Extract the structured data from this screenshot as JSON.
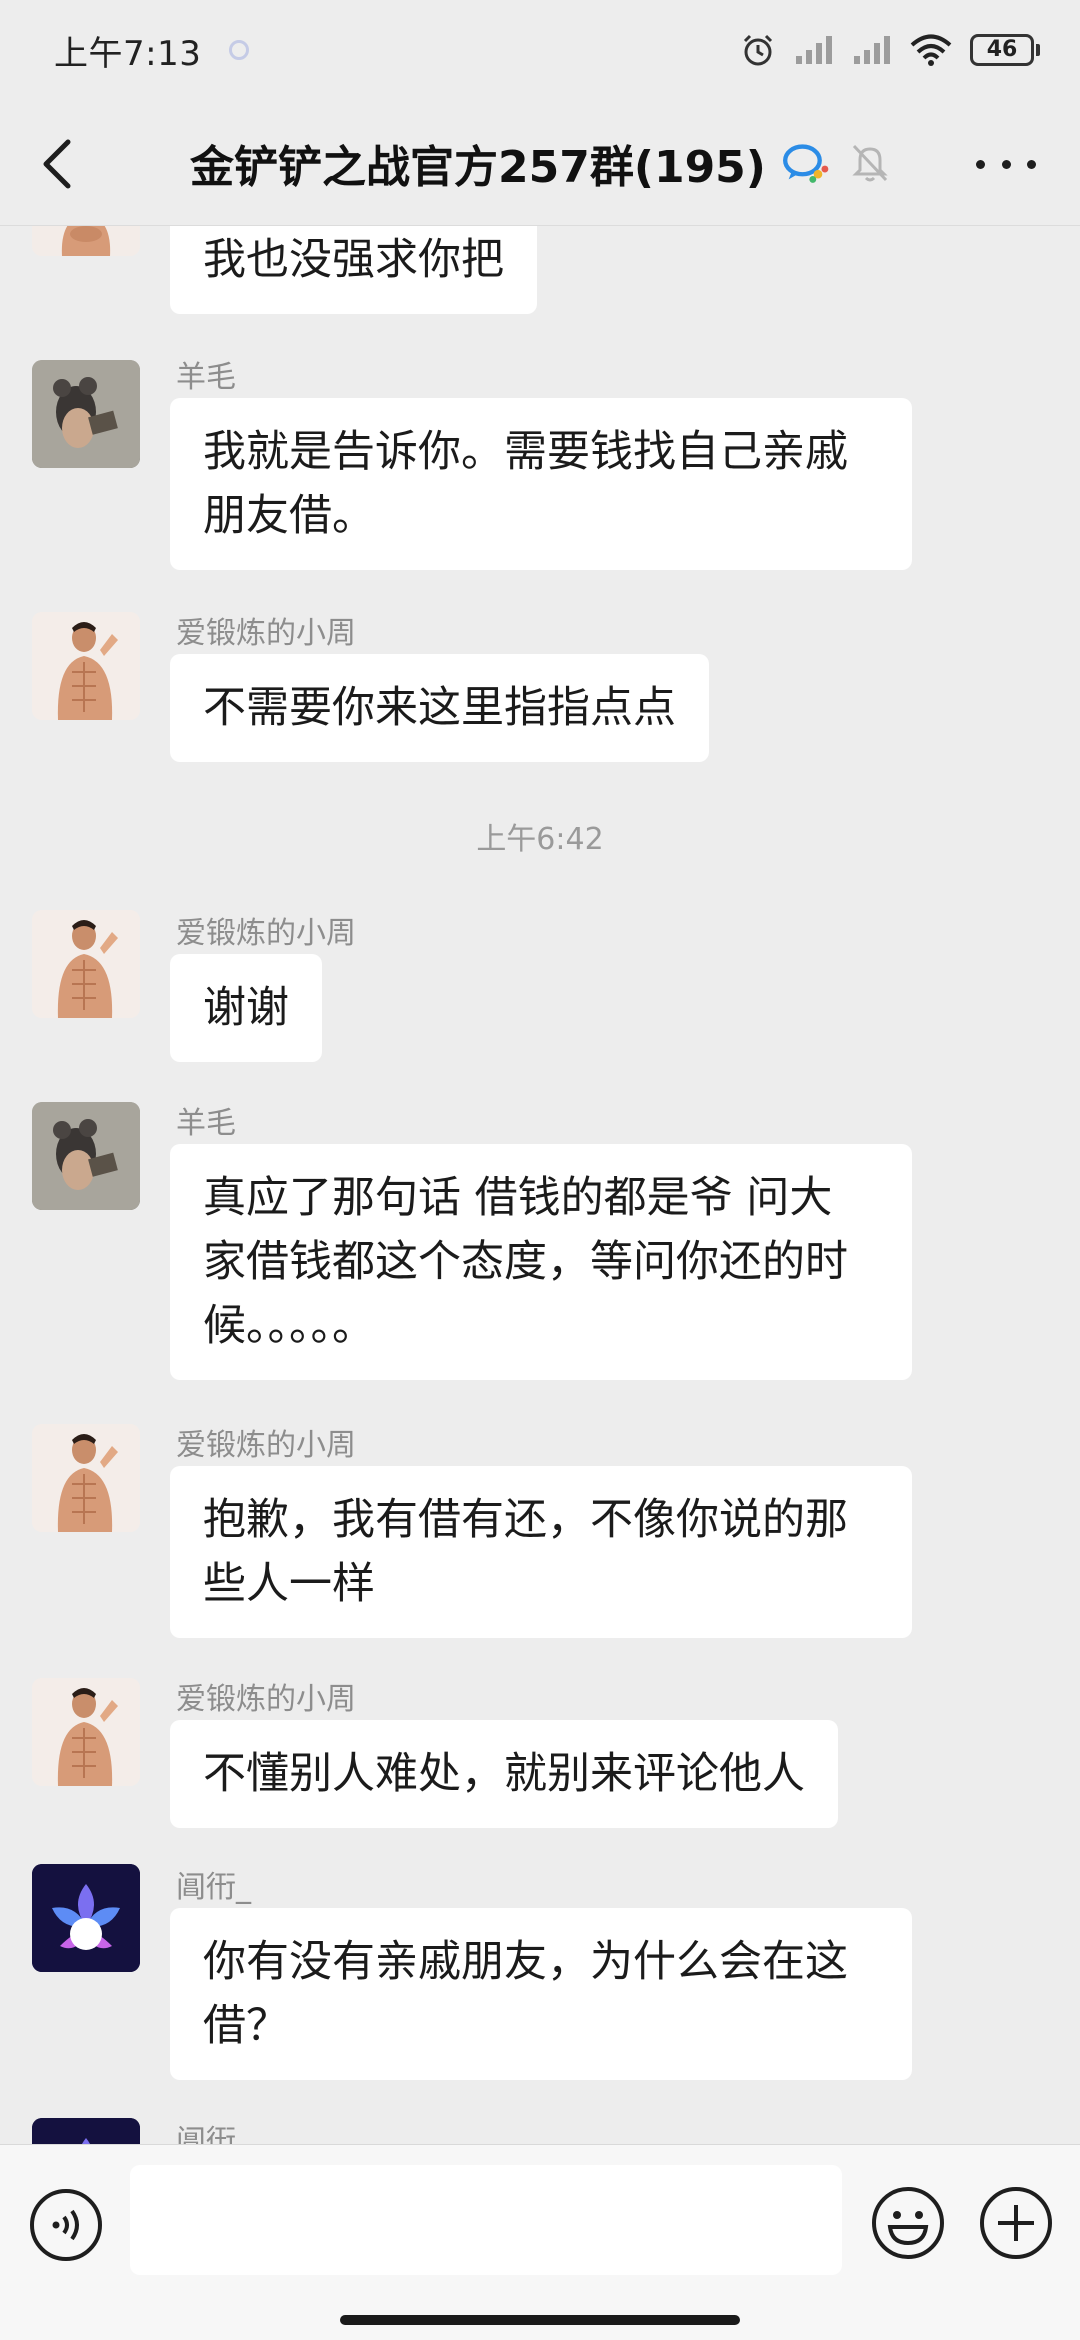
{
  "status_bar": {
    "time": "上午7:13",
    "battery": "46"
  },
  "header": {
    "title": "金铲铲之战官方257群(195)"
  },
  "messages": [
    {
      "sender": "",
      "text": "我也没强求你把",
      "avatar": "muscle-man"
    },
    {
      "sender": "羊毛",
      "text": "我就是告诉你。需要钱找自己亲戚\n朋友借。",
      "avatar": "mouse"
    },
    {
      "sender": "爱锻炼的小周",
      "text": "不需要你来这里指指点点",
      "avatar": "muscle-man"
    },
    {
      "sender": "爱锻炼的小周",
      "text": "谢谢",
      "avatar": "muscle-man"
    },
    {
      "sender": "羊毛",
      "text": "真应了那句话 借钱的都是爷 问大\n家借钱都这个态度，等问你还的时\n候。。。。。",
      "avatar": "mouse"
    },
    {
      "sender": "爱锻炼的小周",
      "text": "抱歉，我有借有还，不像你说的那\n些人一样",
      "avatar": "muscle-man"
    },
    {
      "sender": "爱锻炼的小周",
      "text": "不懂别人难处，就别来评论他人",
      "avatar": "muscle-man"
    },
    {
      "sender": "阊衎_",
      "text": "你有没有亲戚朋友，为什么会在这\n借？",
      "avatar": "lotus"
    },
    {
      "sender": "阊衎",
      "text": "",
      "avatar": "lotus"
    }
  ],
  "timestamp": "上午6:42",
  "input": {
    "value": "",
    "placeholder": ""
  },
  "colors": {
    "background": "#ededed",
    "bubble": "#ffffff",
    "sender_text": "#8d8d8d"
  },
  "icons": [
    "back-icon",
    "wecom-icon",
    "mute-bell-icon",
    "more-icon",
    "voice-icon",
    "emoji-icon",
    "plus-icon",
    "alarm-icon",
    "signal-icon",
    "wifi-icon",
    "battery-icon"
  ]
}
